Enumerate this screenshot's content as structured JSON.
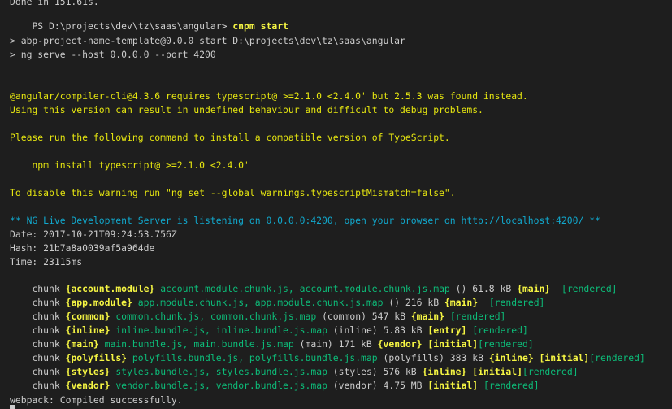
{
  "terminal": {
    "top_partial": "Done in 151.61s.",
    "prompt": "PS D:\\projects\\dev\\tz\\saas\\angular>",
    "command": "cnpm start",
    "npm_run": "> abp-project-name-template@0.0.0 start D:\\projects\\dev\\tz\\saas\\angular",
    "ng_serve": "> ng serve --host 0.0.0.0 --port 4200",
    "warn_line1": "@angular/compiler-cli@4.3.6 requires typescript@'>=2.1.0 <2.4.0' but 2.5.3 was found instead.",
    "warn_line2": "Using this version can result in undefined behaviour and difficult to debug problems.",
    "warn_line3": "Please run the following command to install a compatible version of TypeScript.",
    "warn_line4": "    npm install typescript@'>=2.1.0 <2.4.0'",
    "warn_line5": "To disable this warning run \"ng set --global warnings.typescriptMismatch=false\".",
    "server_msg": "** NG Live Development Server is listening on 0.0.0.0:4200, open your browser on http://localhost:4200/ **",
    "date": "Date: 2017-10-21T09:24:53.756Z",
    "hash": "Hash: 21b7a8a0039af5a964de",
    "time": "Time: 23115ms",
    "chunks": [
      {
        "label": "chunk",
        "name": "{account.module}",
        "files": "account.module.chunk.js, account.module.chunk.js.map",
        "desc": "() 61.8 kB",
        "parent": "{main}",
        "flags": "",
        "rendered": " [rendered]"
      },
      {
        "label": "chunk",
        "name": "{app.module}",
        "files": "app.module.chunk.js, app.module.chunk.js.map",
        "desc": "() 216 kB",
        "parent": "{main}",
        "flags": "",
        "rendered": " [rendered]"
      },
      {
        "label": "chunk",
        "name": "{common}",
        "files": "common.chunk.js, common.chunk.js.map",
        "desc": "(common) 547 kB",
        "parent": "{main}",
        "flags": "",
        "rendered": "[rendered]"
      },
      {
        "label": "chunk",
        "name": "{inline}",
        "files": "inline.bundle.js, inline.bundle.js.map",
        "desc": "(inline) 5.83 kB",
        "parent": "[entry]",
        "flags": "",
        "rendered": "[rendered]"
      },
      {
        "label": "chunk",
        "name": "{main}",
        "files": "main.bundle.js, main.bundle.js.map",
        "desc": "(main) 171 kB",
        "parent": "{vendor}",
        "flags": "[initial]",
        "rendered": "[rendered]"
      },
      {
        "label": "chunk",
        "name": "{polyfills}",
        "files": "polyfills.bundle.js, polyfills.bundle.js.map",
        "desc": "(polyfills) 383 kB",
        "parent": "{inline}",
        "flags": "[initial]",
        "rendered": "[rendered]"
      },
      {
        "label": "chunk",
        "name": "{styles}",
        "files": "styles.bundle.js, styles.bundle.js.map",
        "desc": "(styles) 576 kB",
        "parent": "{inline}",
        "flags": "[initial]",
        "rendered": "[rendered]"
      },
      {
        "label": "chunk",
        "name": "{vendor}",
        "files": "vendor.bundle.js, vendor.bundle.js.map",
        "desc": "(vendor) 4.75 MB",
        "parent": "[initial]",
        "flags": "",
        "rendered": "[rendered]"
      }
    ],
    "compiled": "webpack: Compiled successfully."
  }
}
